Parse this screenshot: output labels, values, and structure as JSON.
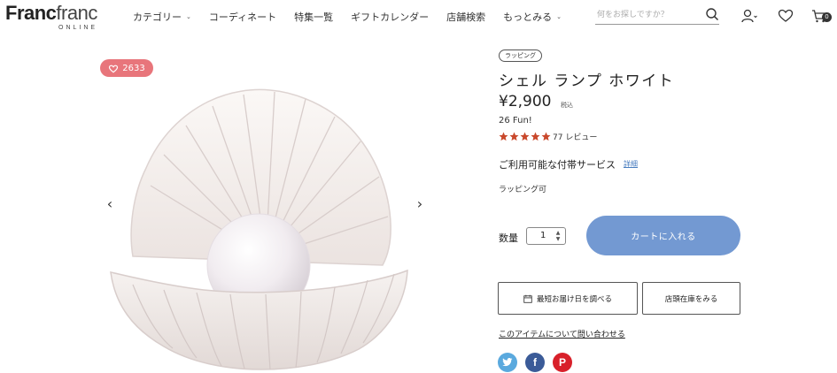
{
  "header": {
    "logo_main_bold": "Franc",
    "logo_main_light": "franc",
    "logo_sub": "ONLINE",
    "nav": [
      {
        "label": "カテゴリー",
        "has_dropdown": true
      },
      {
        "label": "コーディネート",
        "has_dropdown": false
      },
      {
        "label": "特集一覧",
        "has_dropdown": false
      },
      {
        "label": "ギフトカレンダー",
        "has_dropdown": false
      },
      {
        "label": "店舗検索",
        "has_dropdown": false
      },
      {
        "label": "もっとみる",
        "has_dropdown": true
      }
    ],
    "search_placeholder": "何をお探しですか？",
    "cart_count": "0",
    "icons": [
      "search-icon",
      "user-icon",
      "heart-icon",
      "cart-icon"
    ]
  },
  "gallery": {
    "like_count": "2633",
    "prev_arrow": "‹",
    "next_arrow": "›"
  },
  "product": {
    "tag": "ラッピング",
    "title": "シェル ランプ ホワイト",
    "price": "¥2,900",
    "tax_label": "税込",
    "fun_points": "26 Fun!",
    "rating_stars": 5,
    "review_count": "77 レビュー",
    "service_label": "ご利用可能な付帯サービス",
    "detail_link": "詳細",
    "wrapping_available": "ラッピング可",
    "quantity_label": "数量",
    "quantity_value": "1",
    "add_to_cart": "カートに入れる",
    "delivery_button": "最短お届け日を調べる",
    "store_stock_button": "店頭在庫をみる",
    "contact_link": "このアイテムについて問い合わせる"
  },
  "colors": {
    "accent_blue": "#7399d2",
    "like_pink": "#e8757b",
    "star": "#c9482b",
    "twitter": "#5aa9de",
    "facebook": "#3b5b98",
    "pinterest": "#d8202a",
    "link": "#4a7ec0"
  },
  "social": [
    {
      "name": "twitter",
      "glyph": "t"
    },
    {
      "name": "facebook",
      "glyph": "f"
    },
    {
      "name": "pinterest",
      "glyph": "P"
    }
  ]
}
